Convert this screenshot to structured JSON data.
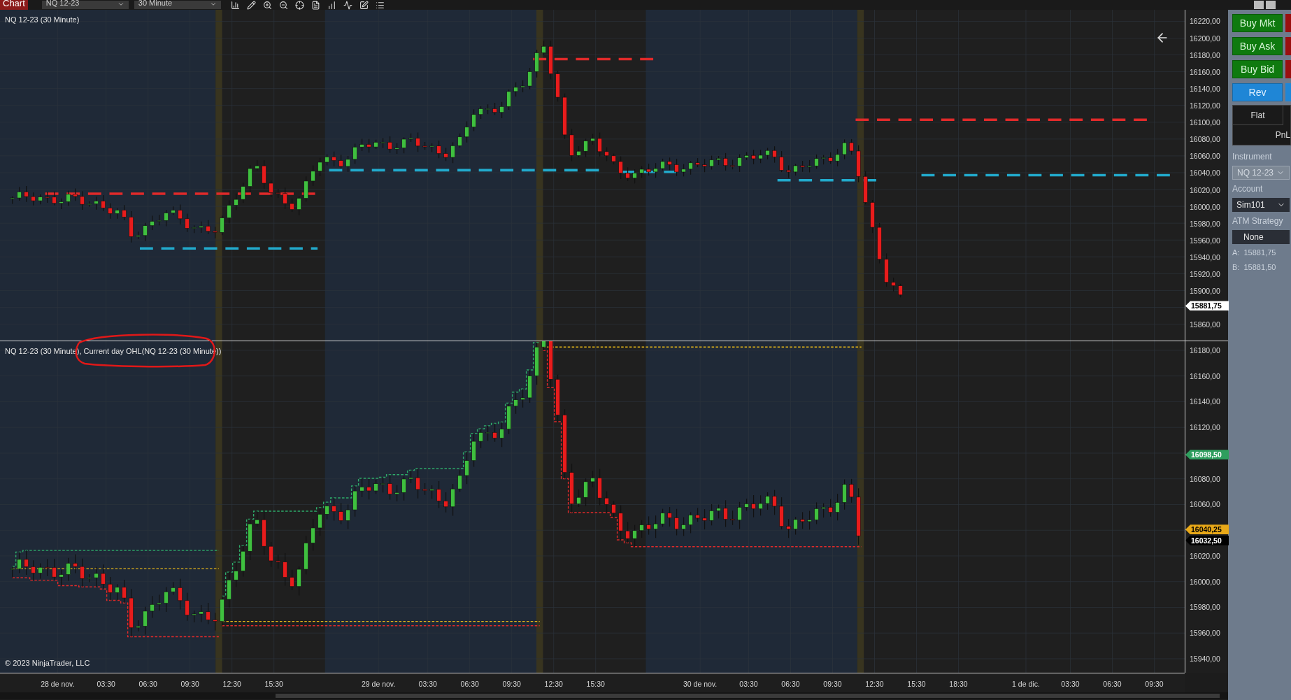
{
  "toolbar": {
    "tab": "Chart",
    "instrument": "NQ 12-23",
    "interval": "30 Minute"
  },
  "panels": [
    {
      "legend": "NQ 12-23 (30 Minute)",
      "yticks": [
        "16220,00",
        "16200,00",
        "16180,00",
        "16160,00",
        "16140,00",
        "16120,00",
        "16100,00",
        "16080,00",
        "16060,00",
        "16040,00",
        "16020,00",
        "16000,00",
        "15980,00",
        "15960,00",
        "15940,00",
        "15920,00",
        "15900,00",
        "15860,00"
      ],
      "markers": [
        {
          "text": "15881,75",
          "color": "#ffffff"
        }
      ]
    },
    {
      "legend": "NQ 12-23 (30 Minute), Current day OHL(NQ 12-23 (30 Minute))",
      "yticks": [
        "16180,00",
        "16160,00",
        "16140,00",
        "16120,00",
        "16080,00",
        "16060,00",
        "16020,00",
        "16000,00",
        "15980,00",
        "15960,00",
        "15940,00"
      ],
      "markers": [
        {
          "text": "16098,50",
          "color": "#2e9e5e"
        },
        {
          "text": "16040,25",
          "color": "#e8a818"
        },
        {
          "text": "16032,50",
          "color": "#000000"
        }
      ]
    }
  ],
  "copyright": "© 2023 NinjaTrader, LLC",
  "time_axis": [
    "28 de nov.",
    "03:30",
    "06:30",
    "09:30",
    "12:30",
    "15:30",
    "29 de nov.",
    "03:30",
    "06:30",
    "09:30",
    "12:30",
    "15:30",
    "30 de nov.",
    "03:30",
    "06:30",
    "09:30",
    "12:30",
    "15:30",
    "18:30",
    "1 de dic.",
    "03:30",
    "06:30",
    "09:30"
  ],
  "order_panel": {
    "buttons": [
      {
        "label": "Buy Mkt",
        "kind": "buy"
      },
      {
        "label": "Buy Ask",
        "kind": "buy"
      },
      {
        "label": "Buy Bid",
        "kind": "buy"
      },
      {
        "label": "Rev",
        "kind": "reverse"
      }
    ],
    "flat": "Flat",
    "pnl": "PnL",
    "instrument_label": "Instrument",
    "instrument": {
      "value": "NQ 12-23",
      "disabled": true
    },
    "account_label": "Account",
    "account": {
      "value": "Sim101",
      "disabled": false
    },
    "atm_label": "ATM Strategy",
    "atm": "None",
    "ask": "A:  15881,75",
    "bid": "B:  15881,50"
  }
}
